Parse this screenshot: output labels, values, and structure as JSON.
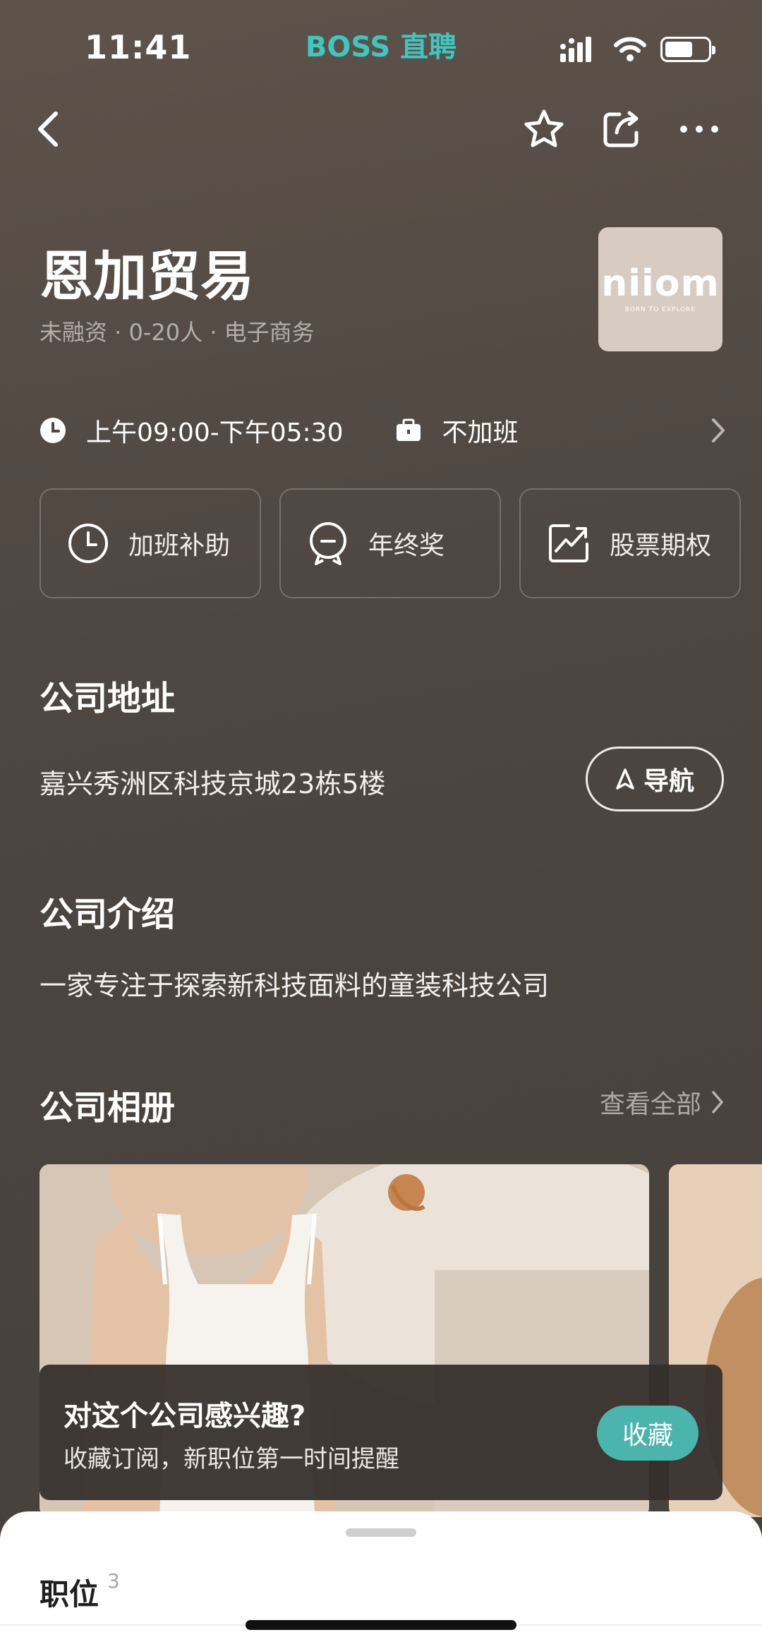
{
  "status_bar": {
    "time": "11:41",
    "brand": "BOSS 直聘",
    "icons": [
      "signal-icon",
      "wifi-icon",
      "battery-icon"
    ],
    "battery_level": 0.65
  },
  "nav": {
    "icons": [
      "back-icon",
      "star-icon",
      "share-icon",
      "more-icon"
    ]
  },
  "company": {
    "name": "恩加贸易",
    "meta": "未融资 · 0-20人 · 电子商务",
    "logo_text": "niiom",
    "logo_tagline": "BORN TO EXPLORE",
    "work_hours": "上午09:00-下午05:30",
    "overtime": "不加班"
  },
  "benefits": [
    {
      "label": "加班补助",
      "icon": "clock-icon"
    },
    {
      "label": "年终奖",
      "icon": "medal-icon"
    },
    {
      "label": "股票期权",
      "icon": "chart-icon"
    }
  ],
  "address": {
    "title": "公司地址",
    "text": "嘉兴秀洲区科技京城23栋5楼",
    "nav_button": "导航"
  },
  "intro": {
    "title": "公司介绍",
    "text": "一家专注于探索新科技面料的童装科技公司"
  },
  "album": {
    "title": "公司相册",
    "see_all": "查看全部"
  },
  "banner": {
    "title": "对这个公司感兴趣?",
    "subtitle": "收藏订阅，新职位第一时间提醒",
    "button": "收藏"
  },
  "sheet": {
    "title": "职位",
    "count": "3"
  },
  "colors": {
    "accent": "#4bb4ad",
    "brand": "#3fc6c0",
    "background": "#4f4741"
  }
}
